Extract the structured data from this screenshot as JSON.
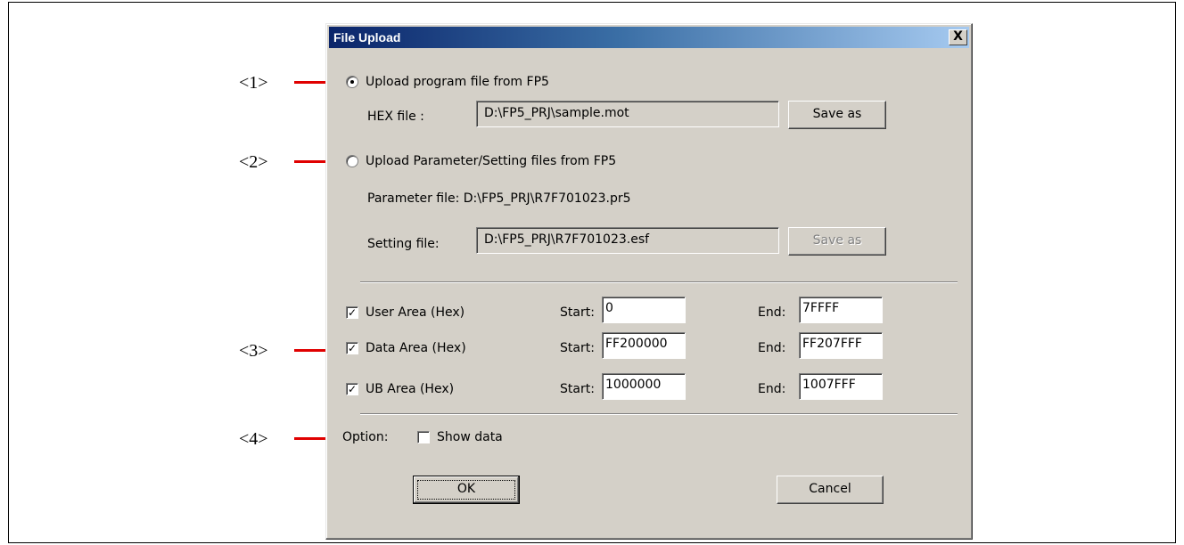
{
  "annotations": [
    "<1>",
    "<2>",
    "<3>",
    "<4>"
  ],
  "dialog": {
    "title": "File Upload",
    "close_label": "X",
    "upload_program": {
      "label": "Upload program file from FP5",
      "selected": true,
      "hex_label": "HEX file :",
      "hex_value": "D:\\FP5_PRJ\\sample.mot",
      "save_label": "Save as"
    },
    "upload_param": {
      "label": "Upload Parameter/Setting files from FP5",
      "selected": false,
      "param_text": "Parameter file: D:\\FP5_PRJ\\R7F701023.pr5",
      "setting_label": "Setting file:",
      "setting_value": "D:\\FP5_PRJ\\R7F701023.esf",
      "save_label": "Save as"
    },
    "areas": [
      {
        "label": "User Area (Hex)",
        "checked": true,
        "start_label": "Start:",
        "start": "0",
        "end_label": "End:",
        "end": "7FFFF"
      },
      {
        "label": "Data Area (Hex)",
        "checked": true,
        "start_label": "Start:",
        "start": "FF200000",
        "end_label": "End:",
        "end": "FF207FFF"
      },
      {
        "label": "UB Area (Hex)",
        "checked": true,
        "start_label": "Start:",
        "start": "1000000",
        "end_label": "End:",
        "end": "1007FFF"
      }
    ],
    "option_label": "Option:",
    "show_data_label": "Show data",
    "show_data_checked": false,
    "ok_label": "OK",
    "cancel_label": "Cancel"
  },
  "colors": {
    "arrow": "#e00000",
    "title_start": "#0a246a",
    "title_end": "#a6caf0",
    "dialog_bg": "#d4d0c8"
  }
}
